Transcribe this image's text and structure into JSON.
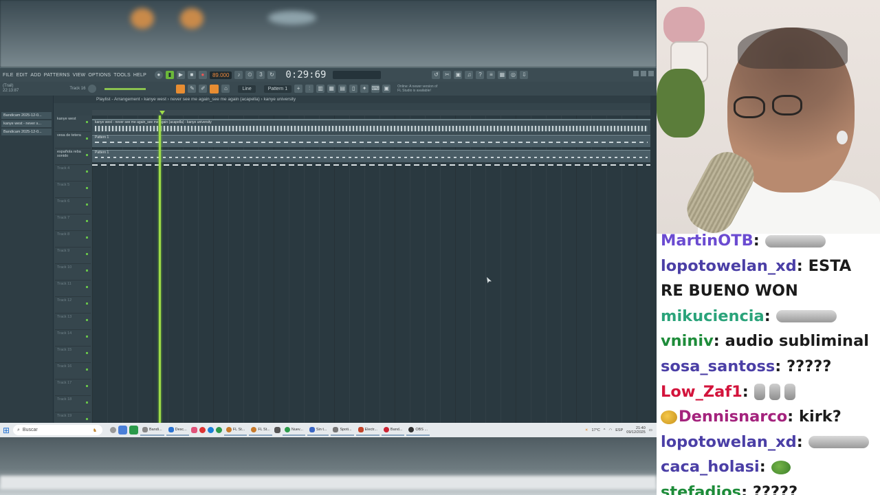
{
  "fl_studio": {
    "menu": [
      "FILE",
      "EDIT",
      "ADD",
      "PATTERNS",
      "VIEW",
      "OPTIONS",
      "TOOLS",
      "HELP"
    ],
    "tempo": "89.000",
    "time": "0:29:69",
    "hint_line1": "(Trail)",
    "hint_line2": "22:13:87",
    "hint_track": "Track 16",
    "snap": "Line",
    "pattern": "Pattern 1",
    "news_line1": "Online: A newer version of",
    "news_line2": "FL Studio is available!",
    "browser_items": [
      "Bandicam 2025-12-0...",
      "kanye west - never s...",
      "Bandicam 2025-12-0..."
    ],
    "playlist_title": "Playlist - Arrangement › kanye west › never see me again_see me again (acapella) › kanye university",
    "tracks": [
      {
        "name": "kanye west"
      },
      {
        "name": "vesa de tetera"
      },
      {
        "name": "española reba sonido"
      },
      {
        "name": "Track 4"
      },
      {
        "name": "Track 5"
      },
      {
        "name": "Track 6"
      },
      {
        "name": "Track 7"
      },
      {
        "name": "Track 8"
      },
      {
        "name": "Track 9"
      },
      {
        "name": "Track 10"
      },
      {
        "name": "Track 11"
      },
      {
        "name": "Track 12"
      },
      {
        "name": "Track 13"
      },
      {
        "name": "Track 14"
      },
      {
        "name": "Track 15"
      },
      {
        "name": "Track 16"
      },
      {
        "name": "Track 17"
      },
      {
        "name": "Track 18"
      },
      {
        "name": "Track 19"
      }
    ],
    "audio_clip_label": "kanye west - never see me again_see me again (acapella) - kanye university",
    "pattern_clip_label": "Pattern 1"
  },
  "taskbar": {
    "search_placeholder": "Buscar",
    "apps": [
      "Bandi...",
      "Desc...",
      "FL St...",
      "FL St...",
      "Nuev...",
      "Sin t...",
      "Spoti...",
      "Electr...",
      "Band...",
      "OBS ..."
    ],
    "temperature": "17°C",
    "language": "ESP",
    "time": "21:40",
    "date": "09/12/2025"
  },
  "colors": {
    "playhead": "#9edb48",
    "accent_orange": "#e88d32"
  },
  "chat": {
    "messages": [
      {
        "user": "MartinOTB",
        "color": "#6b4bd1",
        "text": "",
        "emote": "wide"
      },
      {
        "user": "lopotowelan_xd",
        "color": "#4b3fa6",
        "text": "ESTA RE BUENO WON",
        "emote": ""
      },
      {
        "user": "mikuciencia",
        "color": "#2aa37a",
        "text": "",
        "emote": "wide"
      },
      {
        "user": "vniniv",
        "color": "#1e8c3a",
        "text": "audio subliminal",
        "emote": ""
      },
      {
        "user": "sosa_santoss",
        "color": "#4b3fa6",
        "text": "?????",
        "emote": ""
      },
      {
        "user": "Low_Zaf1",
        "color": "#d3143c",
        "text": "",
        "emote": "triple"
      },
      {
        "user": "Dennisnarco",
        "color": "#a4237d",
        "text": "kirk?",
        "emote": "",
        "badge": true
      },
      {
        "user": "lopotowelan_xd",
        "color": "#4b3fa6",
        "text": "",
        "emote": "wide"
      },
      {
        "user": "caca_holasi",
        "color": "#4b3fa6",
        "text": "",
        "emote": "pepe"
      },
      {
        "user": "stefadios",
        "color": "#1e8c3a",
        "text": "?????",
        "emote": ""
      }
    ]
  }
}
